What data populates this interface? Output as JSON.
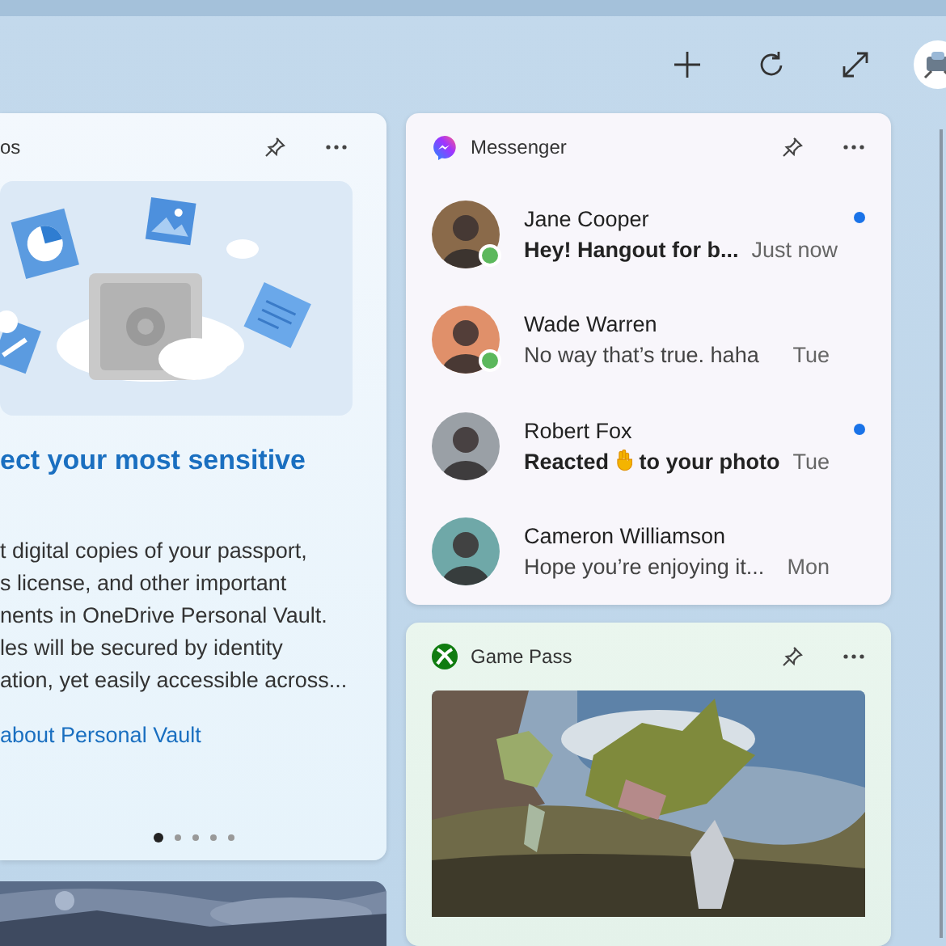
{
  "toolbar": {
    "buttons": [
      {
        "kind": "add"
      },
      {
        "kind": "refresh"
      },
      {
        "kind": "expand"
      }
    ]
  },
  "vault_card": {
    "title": "os",
    "headline": "ect your most sensitive",
    "body_lines": [
      "t digital copies of your passport,",
      "s license, and other important",
      "nents in OneDrive Personal Vault.",
      "les will be secured by identity",
      "ation, yet easily accessible across..."
    ],
    "link": "about Personal Vault",
    "pages": [
      {
        "selected": true
      },
      {
        "selected": false
      },
      {
        "selected": false
      },
      {
        "selected": false
      },
      {
        "selected": false
      }
    ]
  },
  "messenger": {
    "title": "Messenger",
    "messages": [
      {
        "name": "Jane Cooper",
        "preview": [
          "Hey! Hangout for b..."
        ],
        "time": "Just now",
        "unread": true,
        "online": true
      },
      {
        "name": "Wade Warren",
        "preview": [
          "No way that’s true. haha"
        ],
        "time": "Tue",
        "unread": false,
        "online": true
      },
      {
        "name": "Robert Fox",
        "preview": [
          "Reacted",
          "to your photo"
        ],
        "time": "Tue",
        "unread": true,
        "online": false
      },
      {
        "name": "Cameron Williamson",
        "preview": [
          "Hope you’re enjoying it..."
        ],
        "time": "Mon",
        "unread": false,
        "online": false
      }
    ]
  },
  "game_pass": {
    "title": "Game Pass"
  }
}
